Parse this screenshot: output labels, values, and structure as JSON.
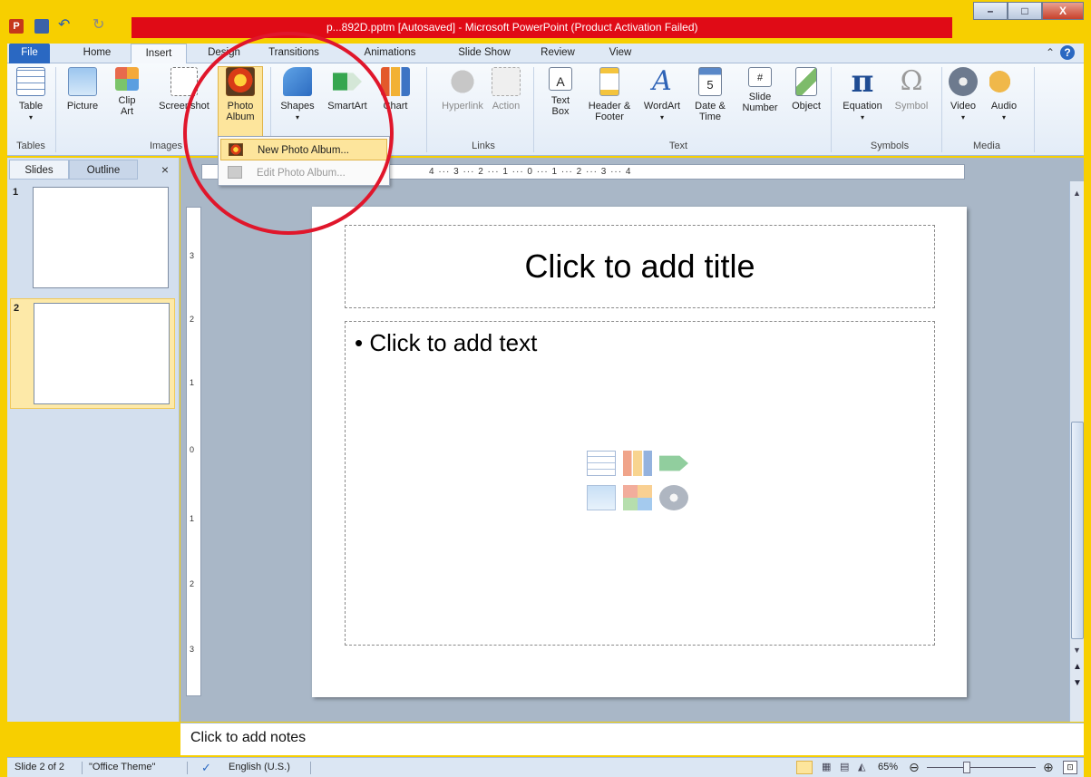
{
  "window": {
    "title": "p...892D.pptm [Autosaved] - Microsoft PowerPoint (Product Activation Failed)",
    "minimize": "–",
    "maximize": "□",
    "close": "X"
  },
  "tabs": [
    {
      "label": "File"
    },
    {
      "label": "Home"
    },
    {
      "label": "Insert"
    },
    {
      "label": "Design"
    },
    {
      "label": "Transitions"
    },
    {
      "label": "Animations"
    },
    {
      "label": "Slide Show"
    },
    {
      "label": "Review"
    },
    {
      "label": "View"
    }
  ],
  "ribbon": {
    "buttons": {
      "table": "Table",
      "picture": "Picture",
      "clip_art": "Clip Art",
      "screenshot": "Screenshot",
      "photo_album": "Photo Album",
      "shapes": "Shapes",
      "smartart": "SmartArt",
      "chart": "Chart",
      "hyperlink": "Hyperlink",
      "action": "Action",
      "text_box": "Text Box",
      "header_footer": "Header & Footer",
      "wordart": "WordArt",
      "date_time": "Date & Time",
      "slide_number": "Slide Number",
      "object": "Object",
      "equation": "Equation",
      "symbol": "Symbol",
      "video": "Video",
      "audio": "Audio"
    },
    "groups": {
      "tables": "Tables",
      "images": "Images",
      "links": "Links",
      "text": "Text",
      "symbols": "Symbols",
      "media": "Media"
    }
  },
  "dropdown": {
    "items": [
      "New Photo Album...",
      "Edit Photo Album..."
    ]
  },
  "left_pane": {
    "tabs": [
      "Slides",
      "Outline"
    ],
    "close": "×",
    "slides": [
      "1",
      "2"
    ]
  },
  "ruler": {
    "horizontal": "4 ··· 3 ··· 2 ··· 1 ··· 0 ··· 1 ··· 2 ··· 3 ··· 4",
    "h_ticks": [
      "3",
      "2",
      "1",
      "0",
      "1",
      "2",
      "3",
      "4"
    ],
    "v_ticks": [
      "3",
      "2",
      "1",
      "0",
      "1",
      "2",
      "3"
    ]
  },
  "slide": {
    "title_placeholder": "Click to add title",
    "body_placeholder": "• Click to add text"
  },
  "notes": {
    "placeholder": "Click to add notes"
  },
  "status": {
    "slide_count": "Slide 2 of 2",
    "theme": "\"Office Theme\"",
    "language": "English (U.S.)",
    "zoom": "65%"
  },
  "colors": {
    "title_bar_highlight": "#e00b16",
    "file_tab": "#2a68c2",
    "annotation_circle": "#e0162b",
    "background": "#f7cf00"
  }
}
